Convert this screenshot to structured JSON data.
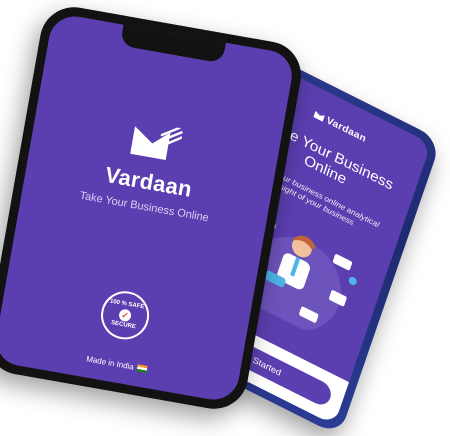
{
  "back_screen": {
    "logo_text": "Vardaan",
    "title": "Take Your Business Online",
    "subtitle": "Move your business online analytical insight of your business",
    "button_label": "Get Started"
  },
  "front_screen": {
    "app_name": "Vardaan",
    "tagline": "Take Your Business Online",
    "badge_top": "100 % SAFE",
    "badge_bottom": "SECURE",
    "made_in": "Made in India"
  },
  "colors": {
    "brand_purple": "#5b3fb0",
    "phone_black": "#121212",
    "phone_blue": "#2a3a8e"
  },
  "icons": [
    "vardaan-logo-icon",
    "safe-secure-badge-icon",
    "india-flag-icon",
    "business-illustration"
  ]
}
